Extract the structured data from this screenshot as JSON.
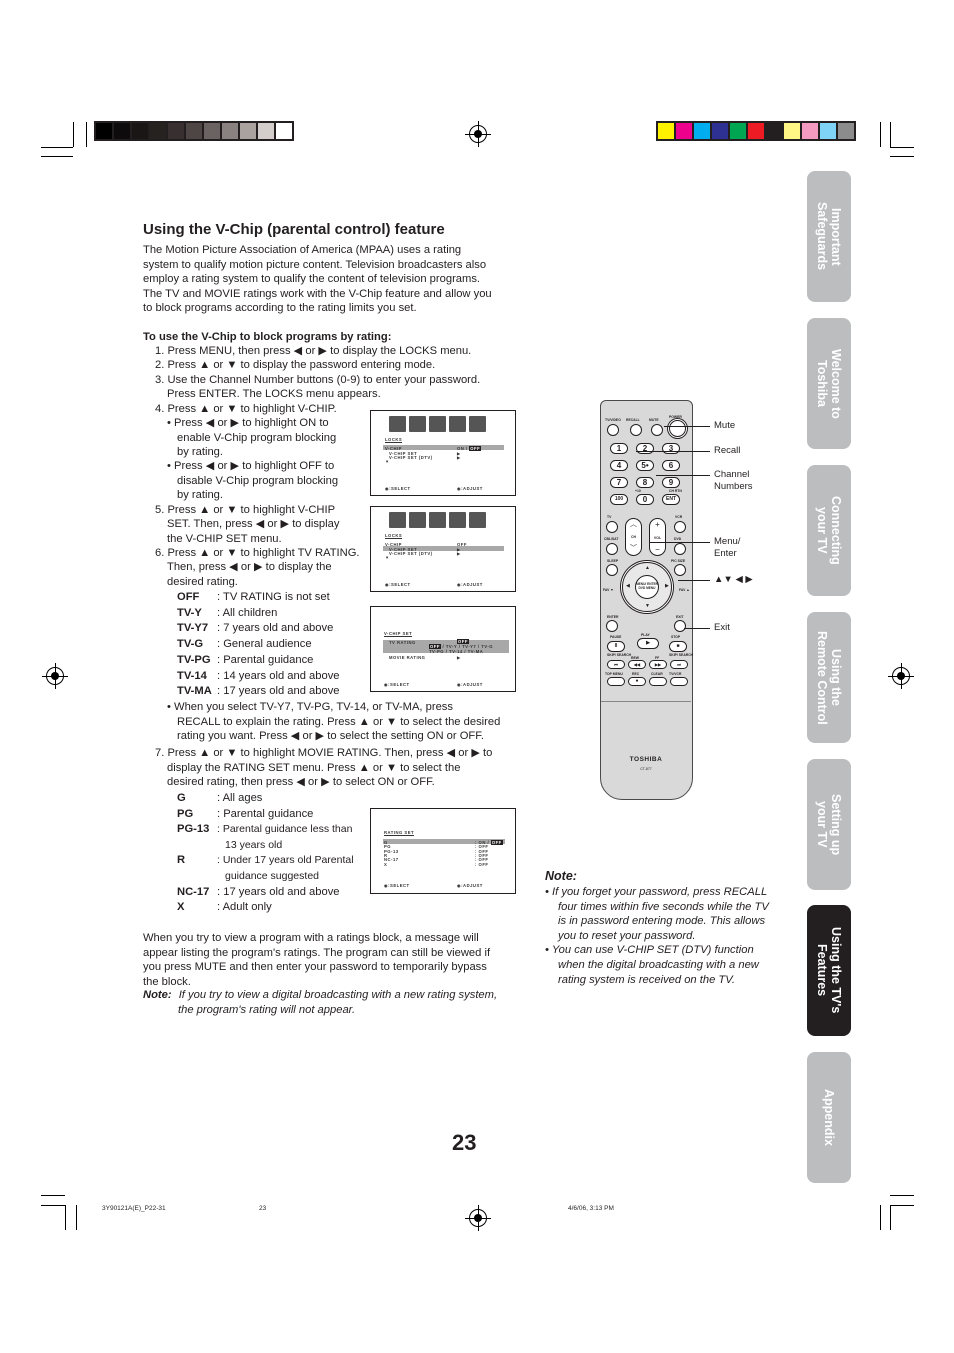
{
  "print_marks": {
    "gray_swatches": [
      "#000000",
      "#0d0b0b",
      "#1a1616",
      "#262220",
      "#383030",
      "#4e4645",
      "#6b6361",
      "#8a8280",
      "#aaa29f",
      "#d3cdcb",
      "#ffffff"
    ],
    "color_swatches": [
      "#fff200",
      "#ec008c",
      "#00aeef",
      "#2e3192",
      "#00a651",
      "#ed1c24",
      "#231f20",
      "#fff685",
      "#f49ac1",
      "#7fd3f7",
      "#8c8c8c"
    ]
  },
  "heading": "Using the V-Chip (parental control) feature",
  "intro": [
    "The Motion Picture Association of America (MPAA) uses a rating",
    "system to qualify motion picture content. Television broadcasters also",
    "employ a rating system to qualify the content of television programs.",
    "The TV and MOVIE ratings work with the V-Chip feature and allow you",
    "to block programs according to the rating limits you set."
  ],
  "procedure_title": "To use the V-Chip to block programs by rating:",
  "steps": [
    "1. Press MENU, then press ◀ or ▶ to display the LOCKS menu.",
    "2. Press ▲ or ▼ to display the password entering mode.",
    "3. Use the Channel Number buttons (0-9) to enter your password.",
    "Press ENTER. The LOCKS menu appears.",
    "4. Press ▲ or ▼ to highlight V-CHIP.",
    "• Press ◀ or ▶ to highlight ON to",
    "enable V-Chip program blocking",
    "by rating.",
    "• Press ◀ or ▶ to highlight OFF to",
    "disable V-Chip program blocking",
    "by rating.",
    "5. Press ▲ or ▼ to highlight V-CHIP",
    "SET. Then, press ◀ or ▶ to display",
    "the V-CHIP SET menu.",
    "6. Press ▲ or ▼ to highlight TV RATING.",
    "Then, press ◀ or ▶ to display the",
    "desired rating."
  ],
  "tv_ratings": [
    {
      "code": "OFF",
      "desc": ": TV RATING is not set"
    },
    {
      "code": "TV-Y",
      "desc": ": All children"
    },
    {
      "code": "TV-Y7",
      "desc": ": 7 years old and above"
    },
    {
      "code": "TV-G",
      "desc": ": General audience"
    },
    {
      "code": "TV-PG",
      "desc": ": Parental guidance"
    },
    {
      "code": "TV-14",
      "desc": ": 14 years old and above"
    },
    {
      "code": "TV-MA",
      "desc": ": 17 years old and above"
    }
  ],
  "recall_bullet": [
    "• When you select TV-Y7, TV-PG, TV-14, or TV-MA, press",
    "RECALL to explain the rating. Press ▲ or ▼ to select the desired",
    "rating you want. Press ◀ or ▶ to select the setting ON or OFF."
  ],
  "step7": [
    "7. Press ▲ or ▼ to highlight MOVIE RATING. Then, press ◀ or ▶ to",
    "display the RATING SET menu. Press ▲ or ▼ to select the",
    "desired rating, then press ◀ or ▶ to select ON or OFF."
  ],
  "movie_ratings": [
    {
      "code": "G",
      "desc": ": All ages"
    },
    {
      "code": "PG",
      "desc": ": Parental guidance"
    },
    {
      "code": "PG-13",
      "desc": ": Parental guidance less than"
    },
    {
      "code": "",
      "desc": "13 years old"
    },
    {
      "code": "R",
      "desc": ": Under 17 years old Parental"
    },
    {
      "code": "",
      "desc": "guidance suggested"
    },
    {
      "code": "NC-17",
      "desc": ": 17 years old and above"
    },
    {
      "code": "X",
      "desc": ": Adult only"
    }
  ],
  "block_para": [
    "When you try to view a program with a ratings block, a message will",
    "appear listing the program's ratings. The program can still be viewed if",
    "you press MUTE and then enter your password to temporarily bypass",
    "the block."
  ],
  "bottom_note": {
    "label": "Note:",
    "lines": [
      "If you try to view a digital broadcasting with a new rating system,",
      "the program's rating will not appear."
    ]
  },
  "osd1": {
    "title": "LOCKS",
    "rows": [
      "V-CHIP",
      "V-CHIP SET",
      "V-CHIP SET (DTV)"
    ],
    "values": [
      "ON / ",
      "OFF",
      "▶",
      "▶"
    ],
    "select": ":SELECT",
    "adjust": ":ADJUST"
  },
  "osd2": {
    "title": "LOCKS",
    "rows": [
      "V-CHIP",
      "V-CHIP SET",
      "V-CHIP SET (DTV)"
    ],
    "values": [
      "OFF",
      "▶",
      "▶"
    ],
    "select": ":SELECT",
    "adjust": ":ADJUST"
  },
  "osd3": {
    "title": "V-CHIP SET",
    "rows": [
      "TV RATING",
      "MOVIE RATING"
    ],
    "top_off": "OFF",
    "opt_off": "OFF",
    "opts1": "/ TV-Y / TV-Y7 / TV-G",
    "opts2": "TV-PG / TV-14 / TV-MA",
    "movie_val": "▶",
    "select": ":SELECT",
    "adjust": ":ADJUST"
  },
  "osd4": {
    "title": "RATING SET",
    "rows": [
      "G",
      "PG",
      "PG-13",
      "R",
      "NC-17",
      "X"
    ],
    "values": [
      ": ON / ",
      ": OFF",
      ": OFF",
      ": OFF",
      ": OFF",
      ": OFF"
    ],
    "off": "OFF",
    "select": ":SELECT",
    "adjust": ":ADJUST"
  },
  "remote": {
    "top_labels": [
      "TV/VIDEO",
      "RECALL",
      "MUTE",
      "POWER"
    ],
    "numbers": [
      "1",
      "2",
      "3",
      "4",
      "5•",
      "6",
      "7",
      "8",
      "9",
      "100",
      "0",
      "ENT"
    ],
    "small_labels": {
      "plus10": "+10",
      "chrtn": "CH RTN",
      "tv": "TV",
      "vcr": "VCR",
      "cbl": "CBL/SAT",
      "dvd": "DVD",
      "ch": "CH",
      "vol": "VOL",
      "sleep": "SLEEP",
      "picsize": "PIC SIZE",
      "fav_down": "FAV ▼",
      "fav_up": "FAV ▲",
      "center": "MENU/ ENTER DVD MENU",
      "enter": "ENTER",
      "exit": "EXIT",
      "pause": "PAUSE",
      "play": "PLAY",
      "stop": "STOP",
      "skip_back": "SKIP/ SEARCH",
      "rew": "REW",
      "ff": "FF",
      "skip_fwd": "SKIP/ SEARCH",
      "topmenu": "TOP MENU",
      "rec": "REC",
      "clear": "CLEAR",
      "tvvcr": "TV/VCR"
    },
    "brand": "TOSHIBA",
    "model": "CT-877"
  },
  "callouts": [
    "Mute",
    "Recall",
    "Channel\nNumbers",
    "Menu/\nEnter",
    "▲▼ ◀ ▶",
    "Exit"
  ],
  "note": {
    "title": "Note:",
    "bullets": [
      [
        "If you forget your password, press RECALL",
        "four times within five seconds while the TV",
        "is in password entering mode. This allows",
        "you to reset your password."
      ],
      [
        "You can use V-CHIP SET (DTV) function",
        "when the digital broadcasting with a new",
        "rating system is received on the TV."
      ]
    ]
  },
  "tabs": [
    {
      "label": "Important\nSafeguards",
      "active": false
    },
    {
      "label": "Welcome to\nToshiba",
      "active": false
    },
    {
      "label": "Connecting\nyour TV",
      "active": false
    },
    {
      "label": "Using the\nRemote Control",
      "active": false
    },
    {
      "label": "Setting up\nyour TV",
      "active": false
    },
    {
      "label": "Using the TV's\nFeatures",
      "active": true
    },
    {
      "label": "Appendix",
      "active": false
    }
  ],
  "page_number": "23",
  "footer": {
    "file": "3Y90121A(E)_P22-31",
    "page": "23",
    "date": "4/6/06, 3:13 PM"
  }
}
